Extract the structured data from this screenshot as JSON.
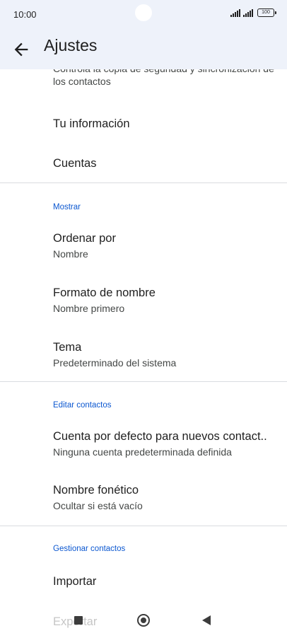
{
  "status_bar": {
    "time": "10:00",
    "battery": "100"
  },
  "app_bar": {
    "title": "Ajustes"
  },
  "partial_description": "Controla la copia de seguridad y sincronización de los contactos",
  "top_items": [
    {
      "title": "Tu información"
    },
    {
      "title": "Cuentas"
    }
  ],
  "sections": {
    "display": {
      "header": "Mostrar",
      "items": [
        {
          "title": "Ordenar por",
          "subtitle": "Nombre"
        },
        {
          "title": "Formato de nombre",
          "subtitle": "Nombre primero"
        },
        {
          "title": "Tema",
          "subtitle": "Predeterminado del sistema"
        }
      ]
    },
    "edit": {
      "header": "Editar contactos",
      "items": [
        {
          "title": "Cuenta por defecto para nuevos contact..",
          "subtitle": "Ninguna cuenta predeterminada definida"
        },
        {
          "title": "Nombre fonético",
          "subtitle": "Ocultar si está vacío"
        }
      ]
    },
    "manage": {
      "header": "Gestionar contactos",
      "items": [
        {
          "title": "Importar"
        },
        {
          "title": "Exportar"
        }
      ]
    }
  },
  "nav_bar": {
    "recents_icon": "square-icon",
    "home_icon": "circle-icon",
    "back_icon": "triangle-back-icon"
  },
  "colors": {
    "accent": "#0b57d0",
    "app_bar_bg": "#eef2fa"
  }
}
